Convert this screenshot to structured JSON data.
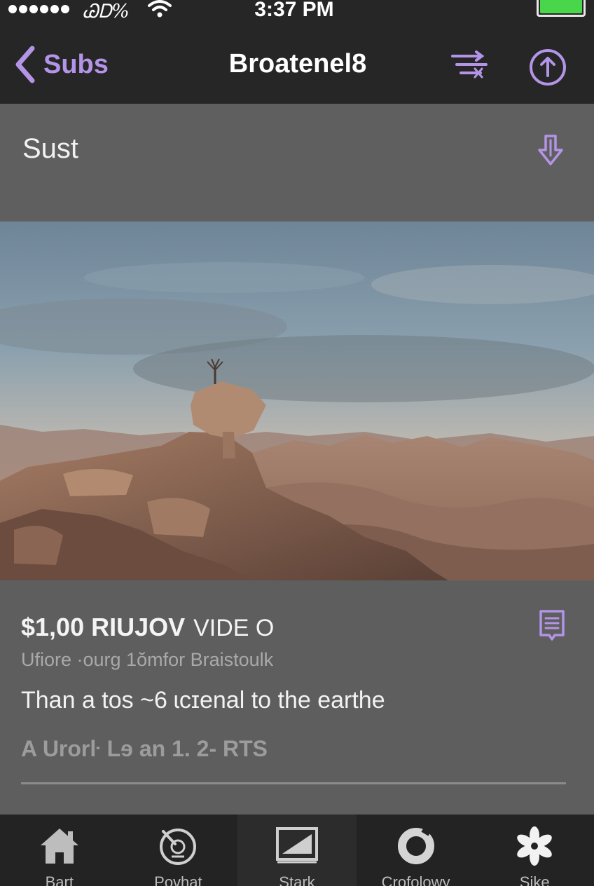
{
  "status_bar": {
    "carrier": "ᏊᎠ%",
    "time": "3:37 PM",
    "signal_icon": "signal-dots-icon",
    "wifi_icon": "wifi-icon",
    "battery_icon": "battery-icon",
    "battery_color": "#4ad64a"
  },
  "nav": {
    "back_label": "Subs",
    "title": "Broatenel8",
    "back_icon": "chevron-left-icon",
    "filter_icon": "filter-icon",
    "upload_icon": "upload-circle-icon",
    "accent_color": "#b394e6"
  },
  "section": {
    "title": "Sust",
    "download_icon": "download-arrow-icon"
  },
  "hero": {
    "image": "desert-rock-landscape"
  },
  "item": {
    "headline_bold": "$1,00 RIUJOV",
    "headline_light": "VIDE O",
    "subline": "Ufiore ·ourg 1ŏmfor Braistoulk",
    "description": "Than a tos ~6 ɩcɪenal to the earthe",
    "meta": "A Urorŀ Lɘ an 1. 2- RTS",
    "notes_icon": "notes-icon"
  },
  "tabs": [
    {
      "label": "Bart",
      "icon": "home-icon",
      "active": false
    },
    {
      "label": "Povhat",
      "icon": "timer-icon",
      "active": false
    },
    {
      "label": "Stark",
      "icon": "media-icon",
      "active": true
    },
    {
      "label": "Crofolowy",
      "icon": "ring-icon",
      "active": false
    },
    {
      "label": "Sike",
      "icon": "asterisk-icon",
      "active": false
    }
  ]
}
